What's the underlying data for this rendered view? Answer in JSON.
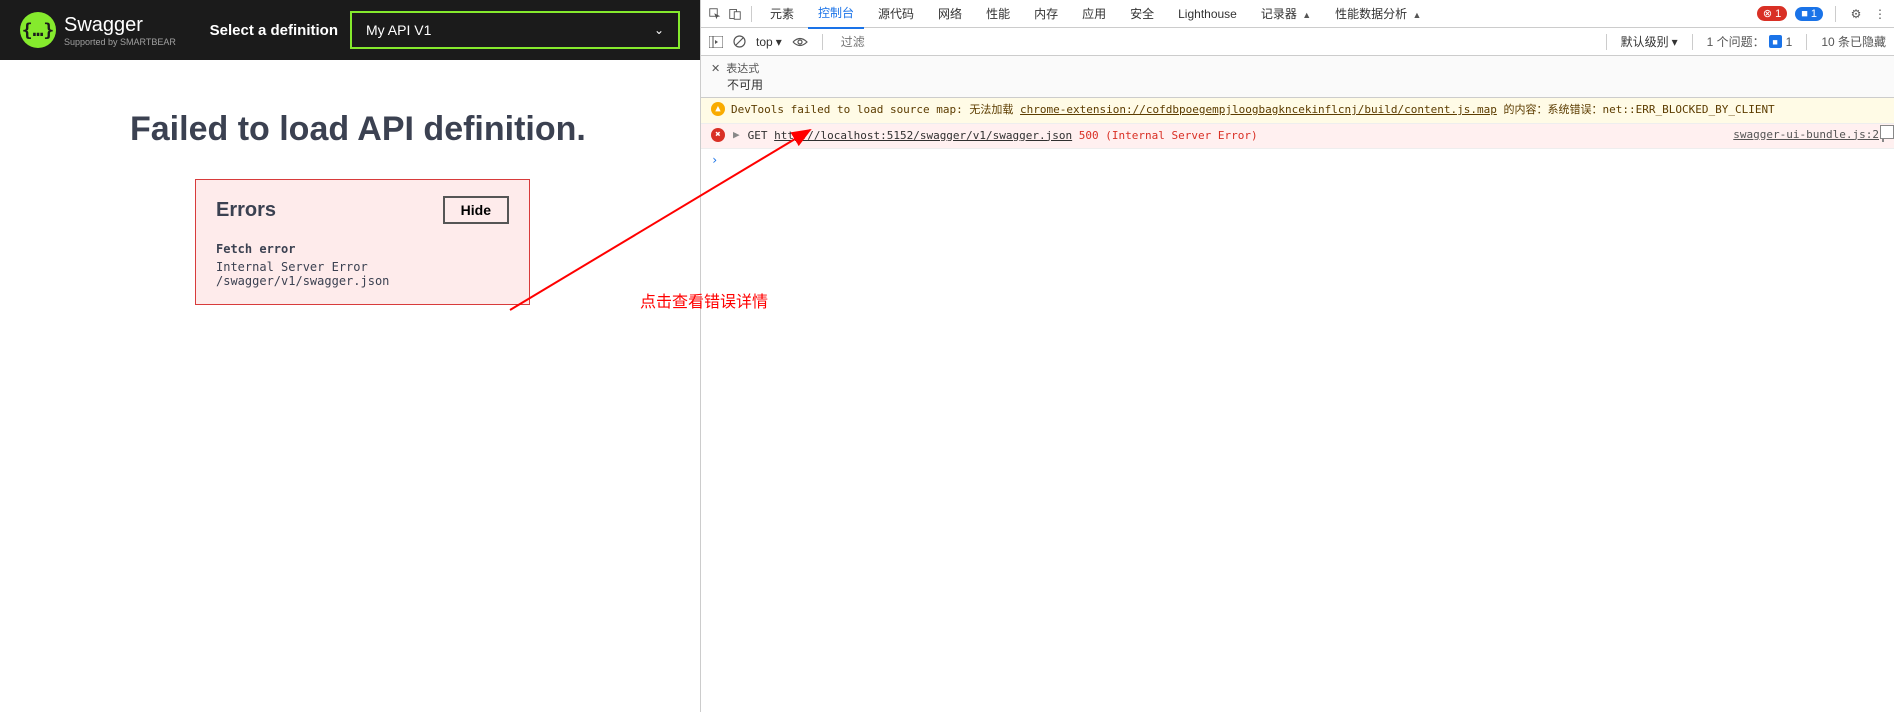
{
  "swagger": {
    "logo_braces": "{…}",
    "logo_text": "Swagger",
    "logo_sub": "Supported by SMARTBEAR",
    "select_label": "Select a definition",
    "selected_def": "My API V1",
    "error_page_title": "Failed to load API definition.",
    "errors_title": "Errors",
    "hide_btn": "Hide",
    "fetch_error_label": "Fetch error",
    "fetch_error_detail": "Internal Server Error /swagger/v1/swagger.json"
  },
  "annotation": {
    "text": "点击查看错误详情"
  },
  "devtools": {
    "tabs": {
      "elements": "元素",
      "console": "控制台",
      "sources": "源代码",
      "network": "网络",
      "performance": "性能",
      "memory": "内存",
      "application": "应用",
      "security": "安全",
      "lighthouse": "Lighthouse",
      "recorder": "记录器",
      "perf_insights": "性能数据分析"
    },
    "error_count": "1",
    "info_count": "1",
    "toolbar": {
      "top": "top",
      "filter_placeholder": "过滤",
      "default_level": "默认级别",
      "issues": "1 个问题：",
      "issue_count": "1",
      "hidden": "10 条已隐藏"
    },
    "expression": {
      "label": "表达式",
      "na": "不可用"
    },
    "logs": {
      "warn_prefix": "DevTools failed to load source map: 无法加载 ",
      "warn_url": "chrome-extension://cofdbpoegempjloogbagkncekinflcnj/build/content.js.map",
      "warn_suffix": " 的内容：系统错误：net::ERR_BLOCKED_BY_CLIENT",
      "err_method": "GET ",
      "err_url": "http://localhost:5152/swagger/v1/swagger.json",
      "err_status": " 500 (Internal Server Error)",
      "err_source": "swagger-ui-bundle.js:2"
    }
  }
}
